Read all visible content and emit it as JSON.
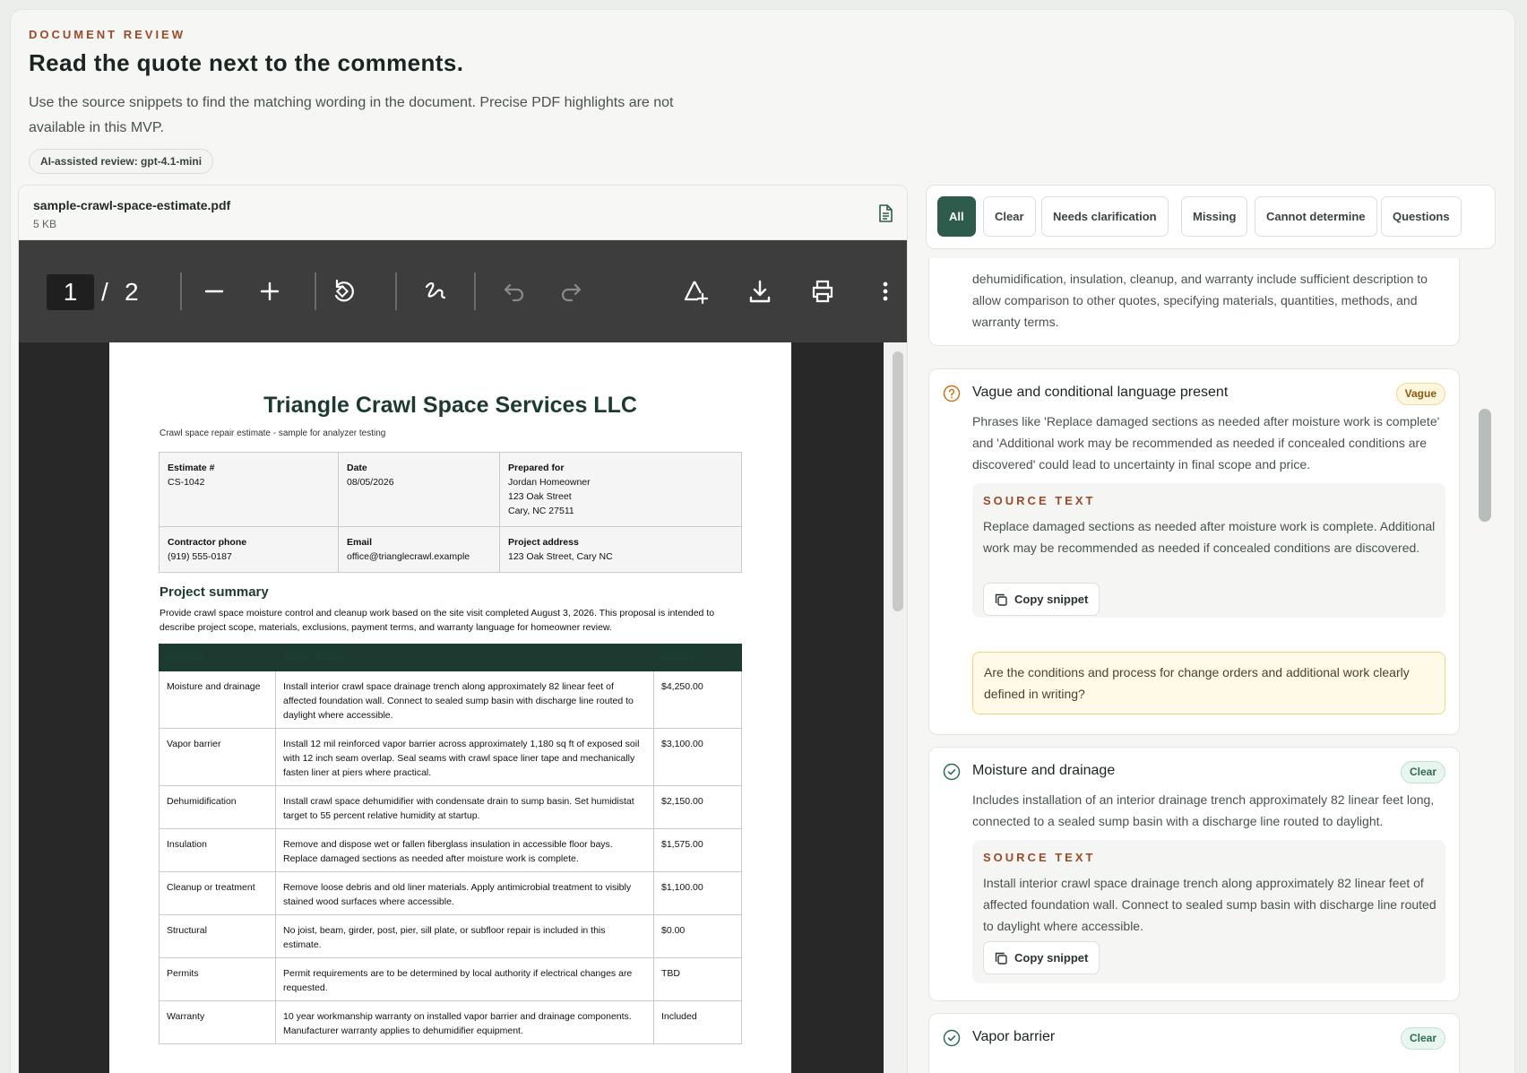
{
  "header": {
    "eyebrow": "DOCUMENT REVIEW",
    "title": "Read the quote next to the comments.",
    "description": "Use the source snippets to find the matching wording in the document. Precise PDF highlights are not available in this MVP.",
    "ai_pill": "AI-assisted review: gpt-4.1-mini"
  },
  "file": {
    "name": "sample-crawl-space-estimate.pdf",
    "size": "5 KB",
    "icon": "document-icon"
  },
  "pdf_toolbar": {
    "page_current": "1",
    "page_sep": "/",
    "page_total": "2",
    "buttons": [
      "zoom-out-icon",
      "zoom-in-icon",
      "rotate-icon",
      "draw-icon",
      "undo-icon",
      "redo-icon",
      "add-text-icon",
      "download-icon",
      "print-icon",
      "more-icon"
    ]
  },
  "pdf": {
    "company": "Triangle Crawl Space Services LLC",
    "subtitle": "Crawl space repair estimate - sample for analyzer testing",
    "info": {
      "estimate_label": "Estimate #",
      "estimate": "CS-1042",
      "date_label": "Date",
      "date": "08/05/2026",
      "prepared_label": "Prepared for",
      "prepared_name": "Jordan Homeowner",
      "prepared_street": "123 Oak Street",
      "prepared_city": "Cary, NC 27511",
      "phone_label": "Contractor phone",
      "phone": "(919) 555-0187",
      "email_label": "Email",
      "email": "office@trianglecrawl.example",
      "address_label": "Project address",
      "address": "123 Oak Street, Cary NC"
    },
    "summary_heading": "Project summary",
    "summary_text": "Provide crawl space moisture control and cleanup work based on the site visit completed August 3, 2026. This proposal is intended to describe project scope, materials, exclusions, payment terms, and warranty language for homeowner review.",
    "table_headers": [
      "Category",
      "Scope of work",
      "Amount"
    ],
    "rows": [
      {
        "category": "Moisture and drainage",
        "scope": "Install interior crawl space drainage trench along approximately 82 linear feet of affected foundation wall. Connect to sealed sump basin with discharge line routed to daylight where accessible.",
        "amount": "$4,250.00"
      },
      {
        "category": "Vapor barrier",
        "scope": "Install 12 mil reinforced vapor barrier across approximately 1,180 sq ft of exposed soil with 12 inch seam overlap. Seal seams with crawl space liner tape and mechanically fasten liner at piers where practical.",
        "amount": "$3,100.00"
      },
      {
        "category": "Dehumidification",
        "scope": "Install crawl space dehumidifier with condensate drain to sump basin. Set humidistat target to 55 percent relative humidity at startup.",
        "amount": "$2,150.00"
      },
      {
        "category": "Insulation",
        "scope": "Remove and dispose wet or fallen fiberglass insulation in accessible floor bays. Replace damaged sections as needed after moisture work is complete.",
        "amount": "$1,575.00"
      },
      {
        "category": "Cleanup or treatment",
        "scope": "Remove loose debris and old liner materials. Apply antimicrobial treatment to visibly stained wood surfaces where accessible.",
        "amount": "$1,100.00"
      },
      {
        "category": "Structural",
        "scope": "No joist, beam, girder, post, pier, sill plate, or subfloor repair is included in this estimate.",
        "amount": "$0.00"
      },
      {
        "category": "Permits",
        "scope": "Permit requirements are to be determined by local authority if electrical changes are requested.",
        "amount": "TBD"
      },
      {
        "category": "Warranty",
        "scope": "10 year workmanship warranty on installed vapor barrier and drainage components. Manufacturer warranty applies to dehumidifier equipment.",
        "amount": "Included"
      }
    ]
  },
  "filters": [
    "All",
    "Clear",
    "Needs clarification",
    "Missing",
    "Cannot determine",
    "Questions"
  ],
  "issues": {
    "partial_desc": "dehumidification, insulation, cleanup, and warranty include sufficient description to allow comparison to other quotes, specifying materials, quantities, methods, and warranty terms.",
    "vague": {
      "icon": "question-circle-icon",
      "title": "Vague and conditional language present",
      "badge": "Vague",
      "desc": "Phrases like 'Replace damaged sections as needed after moisture work is complete' and 'Additional work may be recommended as needed if concealed conditions are discovered' could lead to uncertainty in final scope and price.",
      "source_label": "SOURCE TEXT",
      "source": "Replace damaged sections as needed after moisture work is complete. Additional work may be recommended as needed if concealed conditions are discovered.",
      "copy": "Copy snippet",
      "question": "Are the conditions and process for change orders and additional work clearly defined in writing?"
    },
    "moisture": {
      "icon": "check-circle-icon",
      "title": "Moisture and drainage",
      "badge": "Clear",
      "desc": "Includes installation of an interior drainage trench approximately 82 linear feet long, connected to a sealed sump basin with a discharge line routed to daylight.",
      "source_label": "SOURCE TEXT",
      "source": "Install interior crawl space drainage trench along approximately 82 linear feet of affected foundation wall. Connect to sealed sump basin with discharge line routed to daylight where accessible.",
      "copy": "Copy snippet"
    },
    "vapor": {
      "icon": "check-circle-icon",
      "title": "Vapor barrier",
      "badge": "Clear"
    }
  },
  "colors": {
    "accent": "#2e5c4c",
    "eyebrow": "#9b4a28",
    "vague_bg": "#fff6de",
    "clear_bg": "#e8f6ef"
  }
}
